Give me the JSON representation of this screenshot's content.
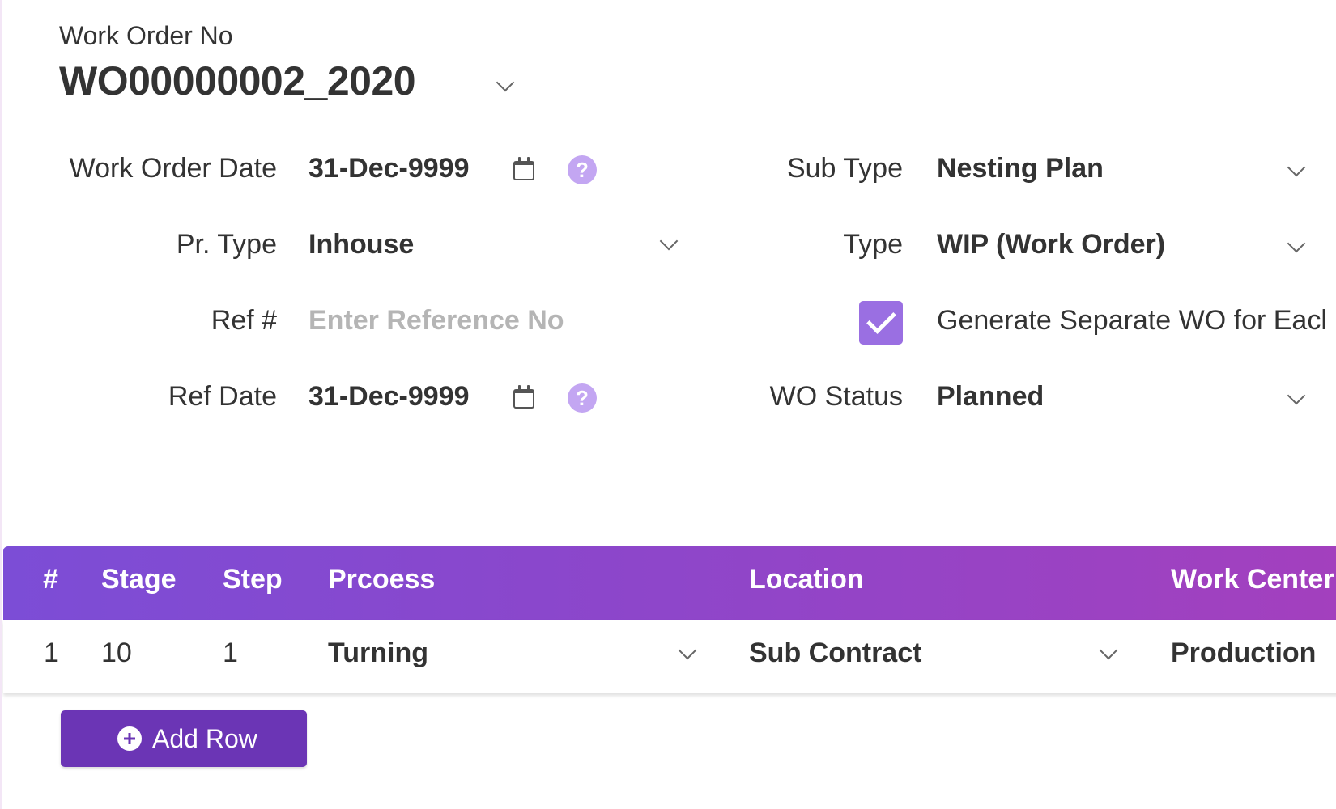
{
  "work_order": {
    "label": "Work Order No",
    "number": "WO00000002_2020"
  },
  "form": {
    "work_order_date": {
      "label": "Work Order Date",
      "value": "31-Dec-9999"
    },
    "pr_type": {
      "label": "Pr. Type",
      "value": "Inhouse"
    },
    "ref_no": {
      "label": "Ref #",
      "placeholder": "Enter Reference No",
      "value": ""
    },
    "ref_date": {
      "label": "Ref Date",
      "value": "31-Dec-9999"
    },
    "sub_type": {
      "label": "Sub Type",
      "value": "Nesting Plan"
    },
    "type": {
      "label": "Type",
      "value": "WIP (Work Order)"
    },
    "generate_separate": {
      "label": "Generate Separate WO for Eacl",
      "checked": true
    },
    "wo_status": {
      "label": "WO Status",
      "value": "Planned"
    },
    "help_glyph": "?"
  },
  "grid": {
    "headers": [
      "#",
      "Stage",
      "Step",
      "Prcoess",
      "Location",
      "Work Center"
    ],
    "rows": [
      {
        "index": "1",
        "stage": "10",
        "step": "1",
        "process": "Turning",
        "location": "Sub Contract",
        "work_center": "Production"
      }
    ]
  },
  "add_row": {
    "label": "Add Row"
  },
  "colors": {
    "accent": "#6b35b5",
    "header_gradient_start": "#7c4dd6",
    "header_gradient_end": "#a340be",
    "checkbox": "#9a6fe2",
    "help_icon": "#c3a6f2"
  },
  "icons": [
    "chevron-down-icon",
    "calendar-icon",
    "help-icon",
    "check-icon",
    "plus-circle-icon"
  ]
}
